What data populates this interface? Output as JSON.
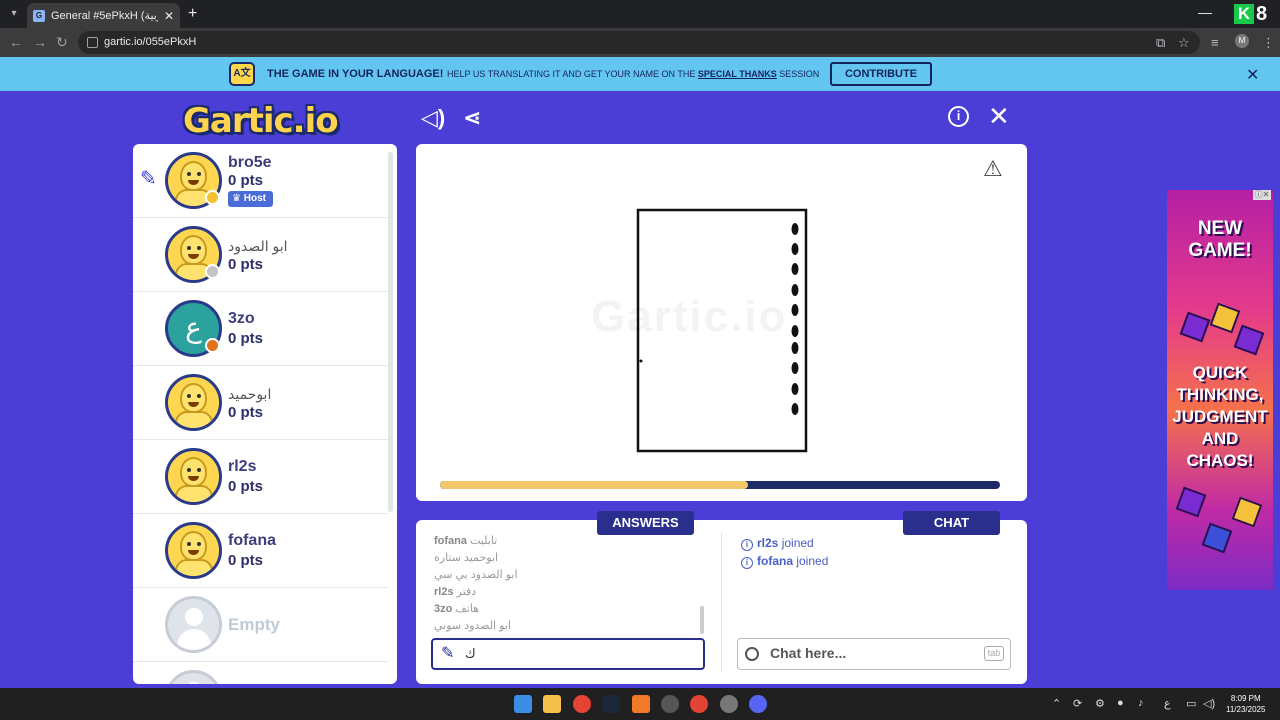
{
  "browser": {
    "tab_title": "General #5ePkxH (العربية) - Gartic",
    "url": "gartic.io/055ePkxH",
    "k8_letter": "K",
    "k8_digit": "8"
  },
  "banner": {
    "title": "THE GAME IN YOUR LANGUAGE!",
    "text_before": "HELP US TRANSLATING IT AND GET YOUR NAME ON THE",
    "text_link": "SPECIAL THANKS",
    "text_after": "SESSION",
    "contribute_label": "CONTRIBUTE"
  },
  "logo": "Gartic.io",
  "players": [
    {
      "name": "bro5e",
      "pts": "0 pts",
      "host": "Host",
      "drawing": true,
      "dot_color": "#f2c230"
    },
    {
      "name": "ابو الصدود",
      "pts": "0 pts",
      "dot_color": "#c4c4c4"
    },
    {
      "name": "3zo",
      "pts": "0 pts",
      "avatar_letter": "ع",
      "dot_color": "#e2731d"
    },
    {
      "name": "ابوحميد",
      "pts": "0 pts"
    },
    {
      "name": "rl2s",
      "pts": "0 pts"
    },
    {
      "name": "fofana",
      "pts": "0 pts"
    },
    {
      "name": "Empty"
    }
  ],
  "canvas": {
    "watermark": "Gartic.io",
    "progress": 0.55
  },
  "answers_label": "ANSWERS",
  "chat_label": "CHAT",
  "answers": [
    {
      "user": "fofana",
      "text": "تابليت"
    },
    {
      "user": "",
      "text": "ابوحميد ستاره"
    },
    {
      "user": "",
      "text": "ابو الصدود بي سي"
    },
    {
      "user": "rl2s",
      "text": "دفتر"
    },
    {
      "user": "3zo",
      "text": "هاتف"
    },
    {
      "user": "",
      "text": "ابو الصدود سوني"
    }
  ],
  "chat": [
    {
      "user": "rl2s",
      "text": "joined"
    },
    {
      "user": "fofana",
      "text": "joined"
    }
  ],
  "answer_input_value": "ك",
  "chat_placeholder": "Chat here...",
  "chat_tab_key": "tab",
  "ad": {
    "headline": "NEW GAME!",
    "body": "QUICK THINKING, JUDGMENT AND CHAOS!"
  },
  "taskbar": {
    "time": "8:09 PM",
    "date": "11/23/2025",
    "lang": "ع"
  },
  "colors": {
    "page_bg": "#4a3ed6",
    "banner_bg": "#63c6f0",
    "accent_dark": "#2a2f8e",
    "progress_fill": "#f2c86a"
  }
}
